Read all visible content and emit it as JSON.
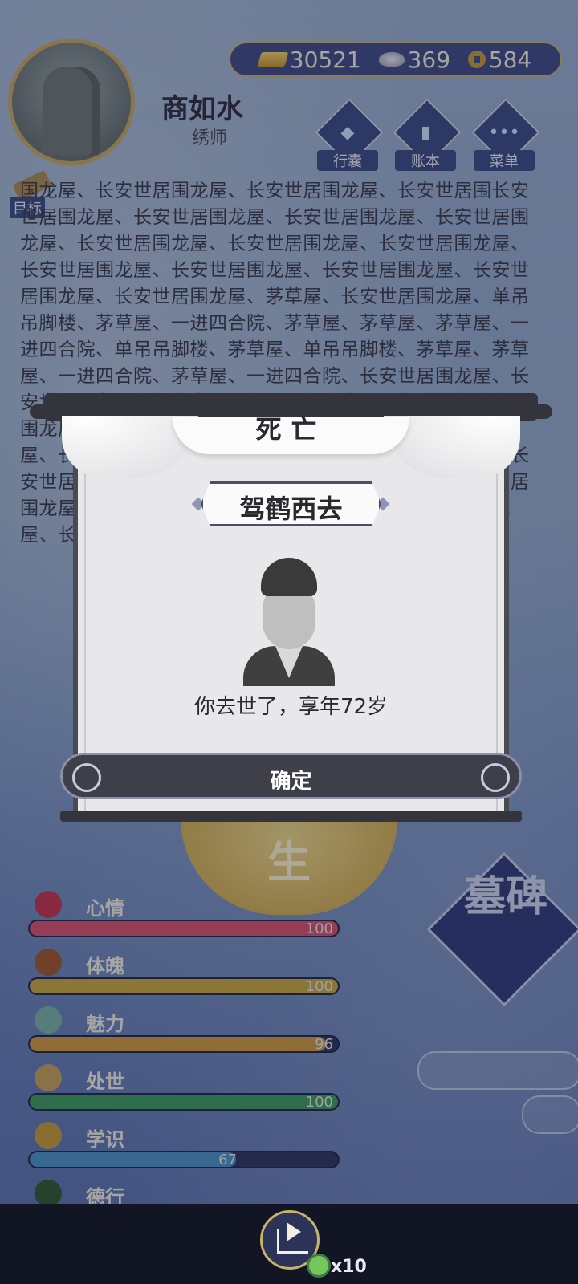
{
  "header": {
    "currency": {
      "gold": "30521",
      "silver": "369",
      "coin": "584"
    },
    "player": {
      "name": "商如水",
      "title": "绣师"
    },
    "menu": [
      {
        "label": "行囊",
        "icon": "bag-icon"
      },
      {
        "label": "账本",
        "icon": "ledger-icon"
      },
      {
        "label": "菜单",
        "icon": "more-icon"
      }
    ],
    "goal_label": "目标"
  },
  "log_text": "国龙屋、长安世居围龙屋、长安世居围龙屋、长安世居围长安世居围龙屋、长安世居围龙屋、长安世居围龙屋、长安世居围龙屋、长安世居围龙屋、长安世居围龙屋、长安世居围龙屋、长安世居围龙屋、长安世居围龙屋、长安世居围龙屋、长安世居围龙屋、长安世居围龙屋、茅草屋、长安世居围龙屋、单吊吊脚楼、茅草屋、一进四合院、茅草屋、茅草屋、茅草屋、一进四合院、单吊吊脚楼、茅草屋、单吊吊脚楼、茅草屋、茅草屋、一进四合院、茅草屋、一进四合院、长安世居围龙屋、长安世居围龙屋、长安世居围龙屋、长安世居围龙屋、长安世居围龙屋、长安世居围龙屋、长安世居围龙屋、长安世居围龙屋、长安世居围龙屋、长安世居围龙屋、长安世居围龙屋、长安世居围龙屋、长安世居围龙屋、长安世居围龙屋、长安世居围龙屋、长安世居围龙屋、长安世居围龙屋、长安世居围龙屋、长安世居围龙屋、长安世居围龙屋、",
  "seal_char": "生",
  "stats": [
    {
      "name": "心情",
      "value": "100",
      "fraction": 1.0,
      "color": "#d9506e"
    },
    {
      "name": "体魄",
      "value": "100",
      "fraction": 1.0,
      "color": "#c9a83e"
    },
    {
      "name": "魅力",
      "value": "96",
      "fraction": 0.96,
      "color": "#d39a3f"
    },
    {
      "name": "处世",
      "value": "100",
      "fraction": 1.0,
      "color": "#3e9b5f"
    },
    {
      "name": "学识",
      "value": "67",
      "fraction": 0.67,
      "color": "#4c93c8"
    },
    {
      "name": "德行",
      "value": "",
      "fraction": 0,
      "color": "#7a3d5a"
    }
  ],
  "tombstone_label": "墓碑",
  "bottom": {
    "multiplier": "x10"
  },
  "modal": {
    "title": "死亡",
    "banner": "驾鹤西去",
    "message": "你去世了，享年72岁",
    "confirm": "确定"
  }
}
